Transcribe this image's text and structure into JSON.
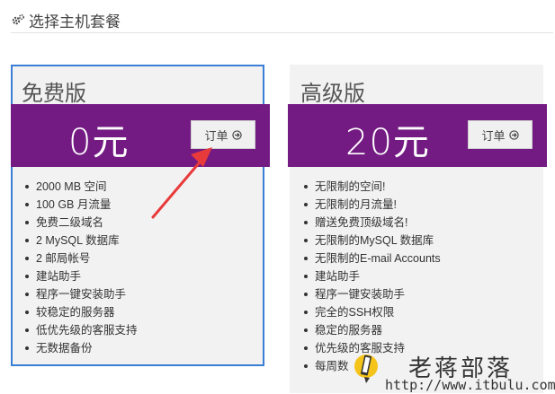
{
  "header": {
    "icon": "gears-icon",
    "title": "选择主机套餐"
  },
  "plans": [
    {
      "name": "免费版",
      "price": "0元",
      "order_label": "订单",
      "selected": true,
      "features": [
        "2000 MB 空间",
        "100 GB 月流量",
        "免费二级域名",
        "2 MySQL 数据库",
        "2 邮局帐号",
        "建站助手",
        "程序一键安装助手",
        "较稳定的服务器",
        "低优先级的客服支持",
        "无数据备份"
      ]
    },
    {
      "name": "高级版",
      "price": "20元",
      "order_label": "订单",
      "selected": false,
      "features": [
        "无限制的空间!",
        "无限制的月流量!",
        "赠送免费顶级域名!",
        "无限制的MySQL 数据库",
        "无限制的E-mail Accounts",
        "建站助手",
        "程序一键安装助手",
        "完全的SSH权限",
        "稳定的服务器",
        "优先级的客服支持",
        "每周数"
      ]
    }
  ],
  "watermark": {
    "name": "老蒋部落",
    "url": "http://www.itbulu.com"
  },
  "colors": {
    "band": "#731a83",
    "selected_border": "#3a7fd5",
    "annotation_arrow": "#e83a3a"
  }
}
